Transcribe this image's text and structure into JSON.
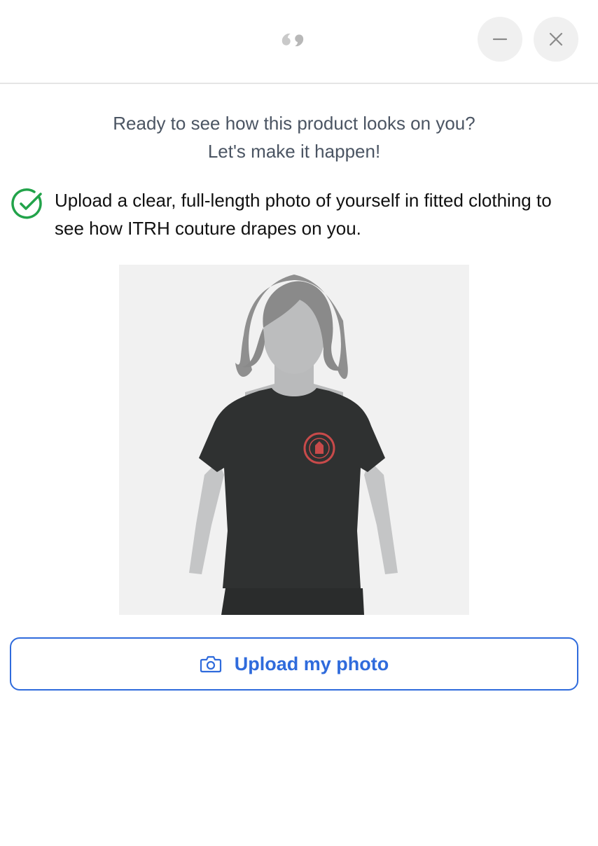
{
  "header": {
    "logo_icon": "quote-mark-logo",
    "minimize_icon": "minus-icon",
    "close_icon": "close-icon"
  },
  "intro": {
    "line1": "Ready to see how this product looks on you?",
    "line2": "Let's make it happen!"
  },
  "tip": {
    "icon": "check-circle-icon",
    "text": "Upload a clear, full-length photo of yourself in fitted clothing to see how ITRH couture drapes on you."
  },
  "example_image": {
    "description_icon": "example-model-silhouette"
  },
  "upload_button": {
    "icon": "camera-icon",
    "label": "Upload my photo"
  },
  "colors": {
    "accent": "#2f6bdc",
    "check": "#22a34a",
    "intro_text": "#4b5563"
  }
}
